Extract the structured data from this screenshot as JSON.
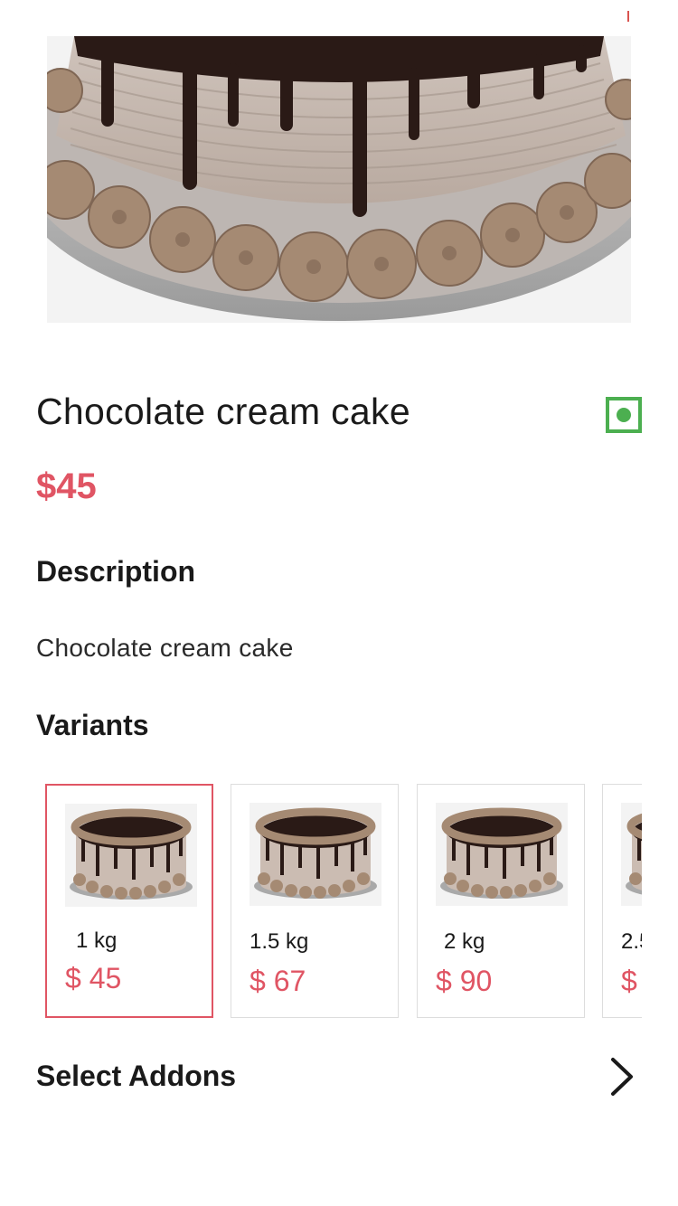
{
  "product": {
    "title": "Chocolate cream cake",
    "price": "$45",
    "veg_indicator_color": "#4caf50"
  },
  "description": {
    "heading": "Description",
    "text": "Chocolate cream cake"
  },
  "variants": {
    "heading": "Variants",
    "items": [
      {
        "weight": "1 kg",
        "price": "$ 45",
        "selected": true
      },
      {
        "weight": "1.5 kg",
        "price": "$ 67",
        "selected": false
      },
      {
        "weight": "2 kg",
        "price": "$ 90",
        "selected": false
      },
      {
        "weight": "2.5",
        "price": "$",
        "selected": false
      }
    ]
  },
  "addons": {
    "label": "Select Addons",
    "icon": "chevron-right-icon"
  },
  "colors": {
    "accent": "#e05564",
    "veg_green": "#4caf50",
    "text": "#1a1a1a"
  }
}
